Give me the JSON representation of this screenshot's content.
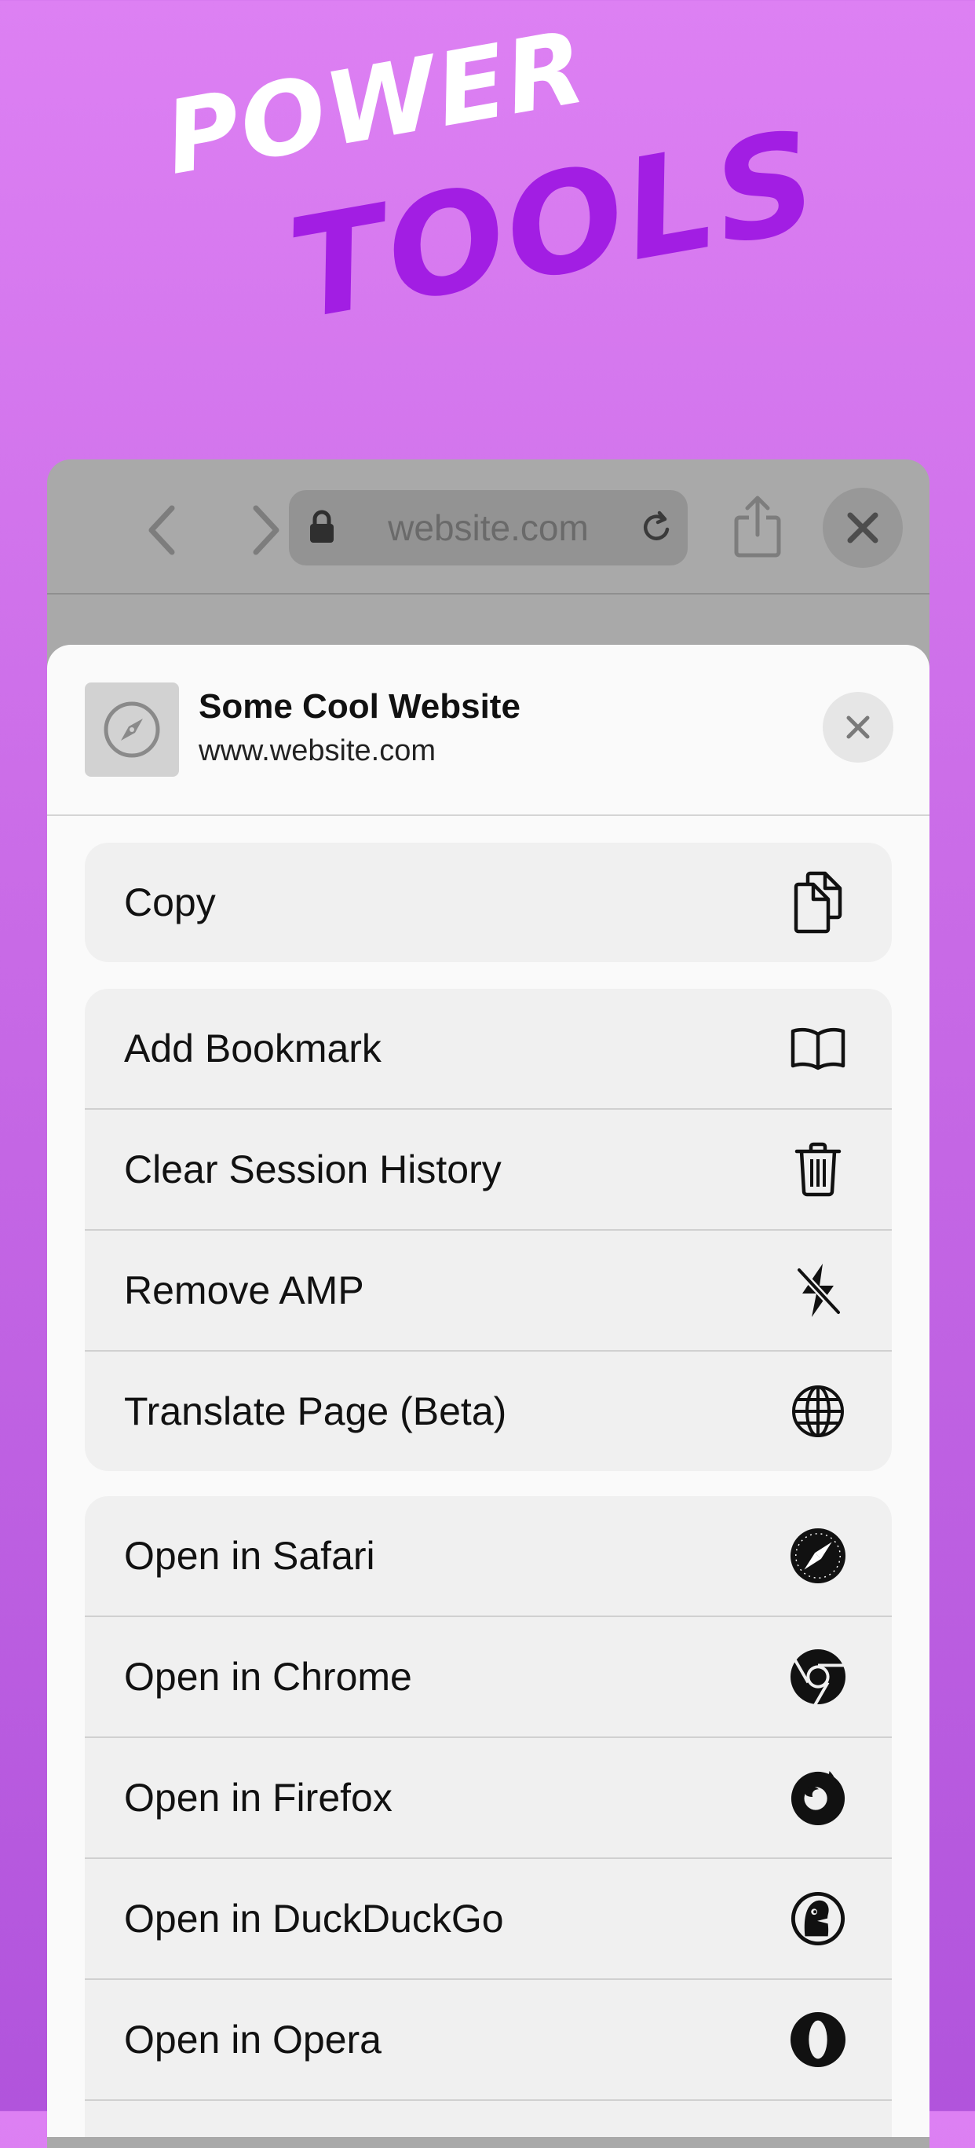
{
  "hero": {
    "line1": "POWER",
    "line2": "TOOLS"
  },
  "browser": {
    "url": "website.com",
    "icons": [
      "back-icon",
      "forward-icon",
      "lock-icon",
      "reload-icon",
      "share-icon",
      "close-icon"
    ]
  },
  "sheet": {
    "title": "Some Cool Website",
    "url": "www.website.com",
    "group1": [
      {
        "label": "Copy",
        "icon": "copy-icon"
      }
    ],
    "group2": [
      {
        "label": "Add Bookmark",
        "icon": "book-icon"
      },
      {
        "label": "Clear Session History",
        "icon": "trash-icon"
      },
      {
        "label": "Remove AMP",
        "icon": "bolt-slash-icon"
      },
      {
        "label": "Translate Page (Beta)",
        "icon": "globe-icon"
      }
    ],
    "group3": [
      {
        "label": "Open in Safari",
        "icon": "safari-icon"
      },
      {
        "label": "Open in Chrome",
        "icon": "chrome-icon"
      },
      {
        "label": "Open in Firefox",
        "icon": "firefox-icon"
      },
      {
        "label": "Open in DuckDuckGo",
        "icon": "duckduckgo-icon"
      },
      {
        "label": "Open in Opera",
        "icon": "opera-icon"
      }
    ]
  }
}
